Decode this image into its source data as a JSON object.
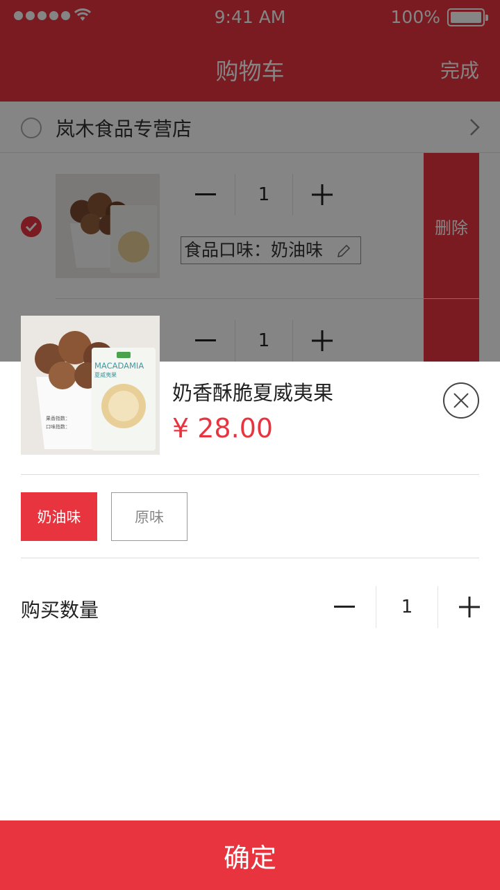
{
  "status_bar": {
    "time": "9:41 AM",
    "battery": "100%"
  },
  "nav": {
    "title": "购物车",
    "done_label": "完成"
  },
  "store": {
    "name": "岚木食品专营店"
  },
  "cart_items": [
    {
      "quantity": "1",
      "flavor_text": "食品口味：奶油味",
      "delete_label": "删除",
      "checked": true
    },
    {
      "quantity": "1"
    }
  ],
  "product_image": {
    "pack_text": "MACADAMIA",
    "pack_sub": "夏威夷果",
    "index_line1": "果香指数：",
    "index_line2": "口味指数："
  },
  "sheet": {
    "product_name": "奶香酥脆夏威夷果",
    "price": "¥ 28.00",
    "options": [
      {
        "label": "奶油味",
        "selected": true
      },
      {
        "label": "原味",
        "selected": false
      }
    ],
    "quantity_label": "购买数量",
    "quantity": "1",
    "confirm_label": "确定"
  },
  "colors": {
    "accent": "#e8343e",
    "overlay": "rgba(0,0,0,0.48)"
  },
  "icons": [
    "signal-dots-icon",
    "wifi-icon",
    "battery-icon",
    "chevron-right-icon",
    "checkmark-icon",
    "pencil-icon",
    "close-icon",
    "minus-icon",
    "plus-icon"
  ]
}
